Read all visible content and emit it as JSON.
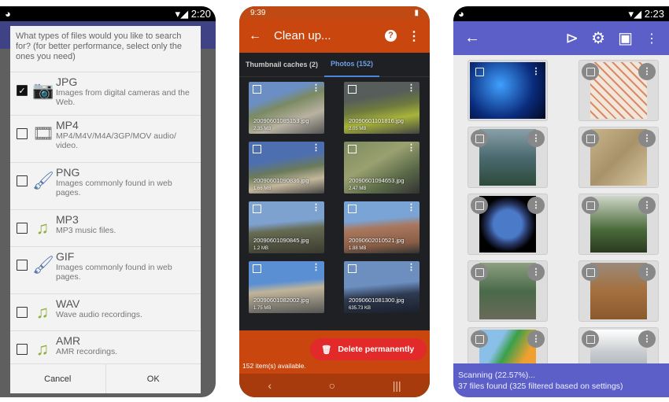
{
  "screen1": {
    "status_time": "2:20",
    "question": "What types of files would you like to search for? (for better performance, select only the ones you need)",
    "file_types": [
      {
        "name": "JPG",
        "desc": "Images from digital cameras and the Web.",
        "checked": true,
        "icon": "camera-icon"
      },
      {
        "name": "MP4",
        "desc": "MP4/M4V/M4A/3GP/MOV audio/ video.",
        "checked": false,
        "icon": "film-reel-icon"
      },
      {
        "name": "PNG",
        "desc": "Images commonly found in web pages.",
        "checked": false,
        "icon": "paint-icon"
      },
      {
        "name": "MP3",
        "desc": "MP3 music files.",
        "checked": false,
        "icon": "music-note-icon"
      },
      {
        "name": "GIF",
        "desc": "Images commonly found in web pages.",
        "checked": false,
        "icon": "paint-icon"
      },
      {
        "name": "WAV",
        "desc": "Wave audio recordings.",
        "checked": false,
        "icon": "music-note-icon"
      },
      {
        "name": "AMR",
        "desc": "AMR recordings.",
        "checked": false,
        "icon": "music-note-icon"
      }
    ],
    "cancel": "Cancel",
    "ok": "OK"
  },
  "screen2": {
    "status_time": "9:39",
    "title": "Clean up...",
    "accent": "#c9470f",
    "tabs": [
      {
        "label": "Thumbnail caches (2)",
        "active": false
      },
      {
        "label": "Photos (152)",
        "active": true
      }
    ],
    "photos": [
      {
        "name": "20090601085153.jpg",
        "size": "2.35 MB"
      },
      {
        "name": "20090601101816.jpg",
        "size": "2.05 MB"
      },
      {
        "name": "20090601090836.jpg",
        "size": "1.66 MB"
      },
      {
        "name": "20090601094653.jpg",
        "size": "2.47 MB"
      },
      {
        "name": "20090601090845.jpg",
        "size": "1.2 MB"
      },
      {
        "name": "20090602010521.jpg",
        "size": "1.88 MB"
      },
      {
        "name": "20090601082002.jpg",
        "size": "1.75 MB"
      },
      {
        "name": "20090601081300.jpg",
        "size": "635.73 KB"
      }
    ],
    "delete_label": "Delete permanently",
    "available": "152 item(s) available."
  },
  "screen3": {
    "status_time": "2:23",
    "accent": "#5b5fc7",
    "scan_status": "Scanning (22.57%)...",
    "scan_progress_percent": 22.57,
    "files_found": "37 files found (325 filtered based on settings)"
  }
}
